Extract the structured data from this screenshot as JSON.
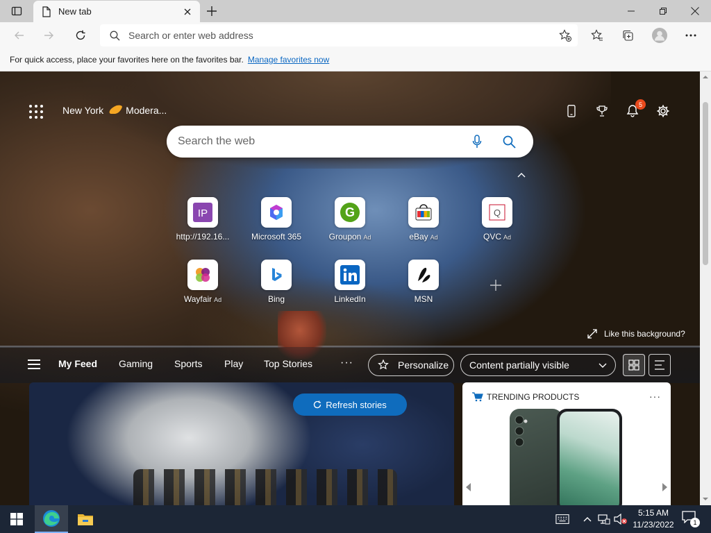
{
  "browser": {
    "tab_title": "New tab",
    "address_placeholder": "Search or enter web address",
    "favorites_bar_text": "For quick access, place your favorites here on the favorites bar.",
    "favorites_bar_link": "Manage favorites now"
  },
  "newtab": {
    "location": "New York",
    "weather_condition": "Modera...",
    "notification_count": "5",
    "search_placeholder": "Search the web",
    "tiles": [
      {
        "label": "http://192.16...",
        "ad": ""
      },
      {
        "label": "Microsoft 365",
        "ad": ""
      },
      {
        "label": "Groupon",
        "ad": "Ad"
      },
      {
        "label": "eBay",
        "ad": "Ad"
      },
      {
        "label": "QVC",
        "ad": "Ad"
      },
      {
        "label": "Wayfair",
        "ad": "Ad"
      },
      {
        "label": "Bing",
        "ad": ""
      },
      {
        "label": "LinkedIn",
        "ad": ""
      },
      {
        "label": "MSN",
        "ad": ""
      }
    ],
    "like_background": "Like this background?",
    "feed_tabs": [
      "My Feed",
      "Gaming",
      "Sports",
      "Play",
      "Top Stories"
    ],
    "more_tabs": "···",
    "personalize_label": "Personalize",
    "content_visibility": "Content partially visible",
    "refresh_stories": "Refresh stories",
    "trending_title": "TRENDING PRODUCTS",
    "card_more": "···"
  },
  "taskbar": {
    "time": "5:15 AM",
    "date": "11/23/2022",
    "notification_count": "1"
  },
  "colors": {
    "accent": "#0f6cbd",
    "badge": "#e8491c",
    "taskbar": "#1c2636"
  }
}
